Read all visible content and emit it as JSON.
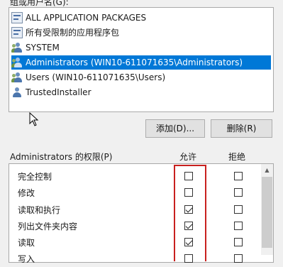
{
  "group_label": "组或用户名(G):",
  "groups": [
    {
      "name": "ALL APPLICATION PACKAGES",
      "icon": "package-icon",
      "selected": false
    },
    {
      "name": "所有受限制的应用程序包",
      "icon": "package-icon",
      "selected": false
    },
    {
      "name": "SYSTEM",
      "icon": "users-icon",
      "selected": false
    },
    {
      "name": "Administrators (WIN10-611071635\\Administrators)",
      "icon": "users-icon",
      "selected": true
    },
    {
      "name": "Users (WIN10-611071635\\Users)",
      "icon": "users-icon",
      "selected": false
    },
    {
      "name": "TrustedInstaller",
      "icon": "user-icon",
      "selected": false
    }
  ],
  "buttons": {
    "add": "添加(D)...",
    "remove": "删除(R)"
  },
  "permissions": {
    "title": "Administrators 的权限(P)",
    "allow_header": "允许",
    "deny_header": "拒绝",
    "items": [
      {
        "name": "完全控制",
        "allow": false,
        "deny": false
      },
      {
        "name": "修改",
        "allow": false,
        "deny": false
      },
      {
        "name": "读取和执行",
        "allow": true,
        "deny": false
      },
      {
        "name": "列出文件夹内容",
        "allow": true,
        "deny": false
      },
      {
        "name": "读取",
        "allow": true,
        "deny": false
      },
      {
        "name": "写入",
        "allow": false,
        "deny": false
      }
    ]
  },
  "colors": {
    "selection": "#0078d7",
    "highlight": "#c8201e"
  }
}
